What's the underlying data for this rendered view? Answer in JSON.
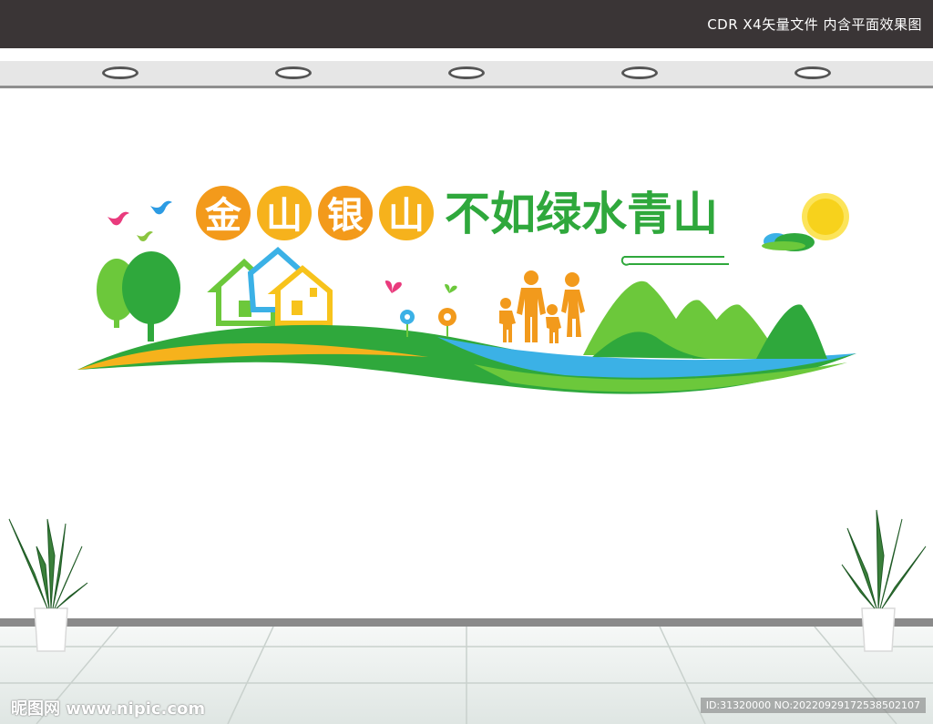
{
  "header": {
    "info_text": "CDR X4矢量文件  内含平面效果图"
  },
  "signage": {
    "title_orange_chars": [
      "金",
      "山",
      "银",
      "山"
    ],
    "title_green": "不如绿水青山"
  },
  "watermark": {
    "left": "昵图网 www.nipic.com",
    "right": "ID:31320000 NO:20220929172538502107"
  },
  "colors": {
    "orange": "#f29a1c",
    "green": "#2fa83c",
    "light_green": "#6cc83b",
    "blue": "#3bb1e6",
    "yellow": "#f7d21c",
    "topbar": "#3a3536"
  },
  "icons": [
    "bird-icon",
    "house-icon",
    "tree-icon",
    "butterfly-icon",
    "flower-icon",
    "family-silhouette-icon",
    "mountain-icon",
    "sun-icon",
    "cloud-icon",
    "plant-icon"
  ]
}
